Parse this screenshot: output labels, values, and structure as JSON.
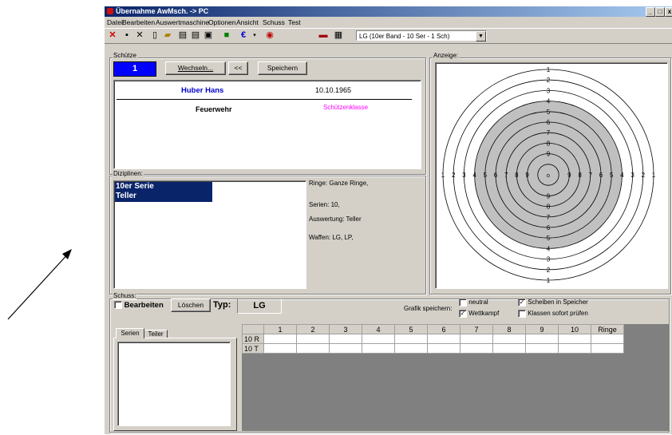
{
  "window": {
    "title": "Übernahme AwMsch. -> PC",
    "min": "_",
    "max": "□",
    "close": "x"
  },
  "menu": [
    "Datei",
    "Bearbeiten",
    "Auswertmaschine",
    "Optionen",
    "Ansicht",
    "Schuss",
    "Test"
  ],
  "toolbar": {
    "icons": [
      "cross-icon",
      "save-icon",
      "delete-icon",
      "new-file-icon",
      "open-folder-icon",
      "print-icon",
      "print-setup-icon",
      "print-preview-icon",
      "camera-icon",
      "euro-icon",
      "dropdown-arrow-icon",
      "target-icon",
      "box-icon",
      "settings-icon"
    ],
    "combo_value": "LG (10er Band - 10 Ser - 1 Sch)"
  },
  "schuetze": {
    "label": "Schütze",
    "number": "1",
    "wechseln": "Wechseln...",
    "back": "<<",
    "speichern": "Speichern",
    "name": "Huber Hans",
    "birthdate": "10.10.1965",
    "club": "Feuerwehr",
    "class_label": "Schützenklasse"
  },
  "disziplinen": {
    "label": "Diziplinen:",
    "items": [
      "10er Serie",
      "Teller"
    ],
    "info": [
      "Ringe: Ganze Ringe,",
      "Serien: 10,",
      "Auswertung: Teller",
      "Waffen: LG, LP,"
    ]
  },
  "anzeige": {
    "label": "Anzeige:",
    "rings": [
      1,
      2,
      3,
      4,
      5,
      6,
      7,
      8,
      9
    ],
    "center": "o"
  },
  "schuss": {
    "label": "Schuss:",
    "bearbeiten": "Bearbeiten",
    "loeschen": "Löschen",
    "typ_label": "Typ:",
    "typ_value": "LG",
    "grafik_label": "Grafik speichern:",
    "options": [
      {
        "label": "neutral",
        "checked": false
      },
      {
        "label": "Wettkampf",
        "checked": true
      },
      {
        "label": "Scheiben in Speicher",
        "checked": true
      },
      {
        "label": "Klassen sofort prüfen",
        "checked": false
      }
    ],
    "tabs": [
      "Serien",
      "Teiler"
    ],
    "grid": {
      "columns": [
        "1",
        "2",
        "3",
        "4",
        "5",
        "6",
        "7",
        "8",
        "9",
        "10",
        "Ringe"
      ],
      "rows": [
        "10 R",
        "10 T"
      ]
    }
  },
  "colors": {
    "highlight": "#0000ff",
    "selection": "#0a246a",
    "name_blue": "#0000cc",
    "magenta": "#ff00ff",
    "target_gray": "#c0c0c0"
  }
}
